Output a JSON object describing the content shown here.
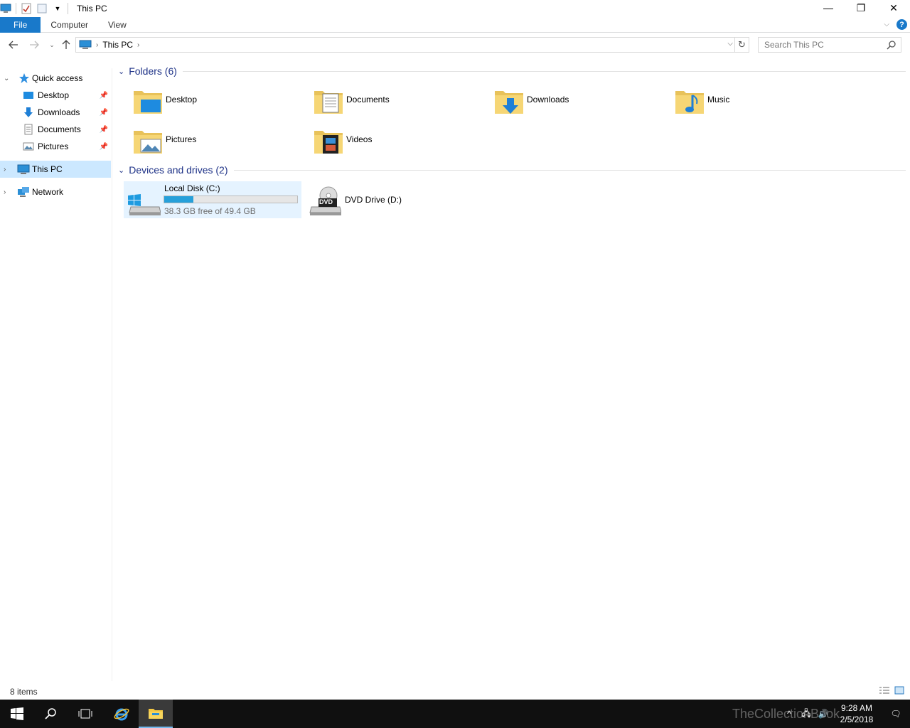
{
  "window": {
    "title": "This PC",
    "minimize": "—",
    "restore": "❐",
    "close": "✕"
  },
  "ribbon": {
    "tabs": [
      {
        "label": "File"
      },
      {
        "label": "Computer"
      },
      {
        "label": "View"
      }
    ],
    "help": "?"
  },
  "address": {
    "path": "This PC",
    "search_placeholder": "Search This PC"
  },
  "nav": {
    "quick_access": "Quick access",
    "pinned": [
      {
        "label": "Desktop"
      },
      {
        "label": "Downloads"
      },
      {
        "label": "Documents"
      },
      {
        "label": "Pictures"
      }
    ],
    "this_pc": "This PC",
    "network": "Network"
  },
  "folders": {
    "header": "Folders (6)",
    "items": [
      {
        "label": "Desktop",
        "icon": "desktop-folder-icon"
      },
      {
        "label": "Documents",
        "icon": "documents-folder-icon"
      },
      {
        "label": "Downloads",
        "icon": "downloads-folder-icon"
      },
      {
        "label": "Music",
        "icon": "music-folder-icon"
      },
      {
        "label": "Pictures",
        "icon": "pictures-folder-icon"
      },
      {
        "label": "Videos",
        "icon": "videos-folder-icon"
      }
    ]
  },
  "drives": {
    "header": "Devices and drives (2)",
    "items": [
      {
        "label": "Local Disk (C:)",
        "free": "38.3 GB free of 49.4 GB",
        "used_fraction": 0.22
      },
      {
        "label": "DVD Drive (D:)",
        "badge": "DVD"
      }
    ]
  },
  "status": {
    "count": "8 items"
  },
  "taskbar": {
    "time": "9:28 AM",
    "date": "2/5/2018",
    "watermark": "TheCollectionBook"
  },
  "colors": {
    "accent": "#1979ca",
    "selection": "#cce8ff",
    "drive_bar": "#26a0da",
    "group_header": "#1e3287"
  }
}
